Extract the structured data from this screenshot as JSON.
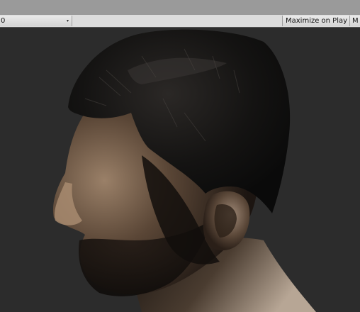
{
  "toolbar": {
    "aspect_value": "0",
    "aspect_arrow": "▾",
    "maximize_on_play": "Maximize on Play",
    "truncated_toggle": "M"
  },
  "viewport": {
    "scene_subject": "3d-head-model-profile",
    "background_color": "#2c2c2c"
  }
}
